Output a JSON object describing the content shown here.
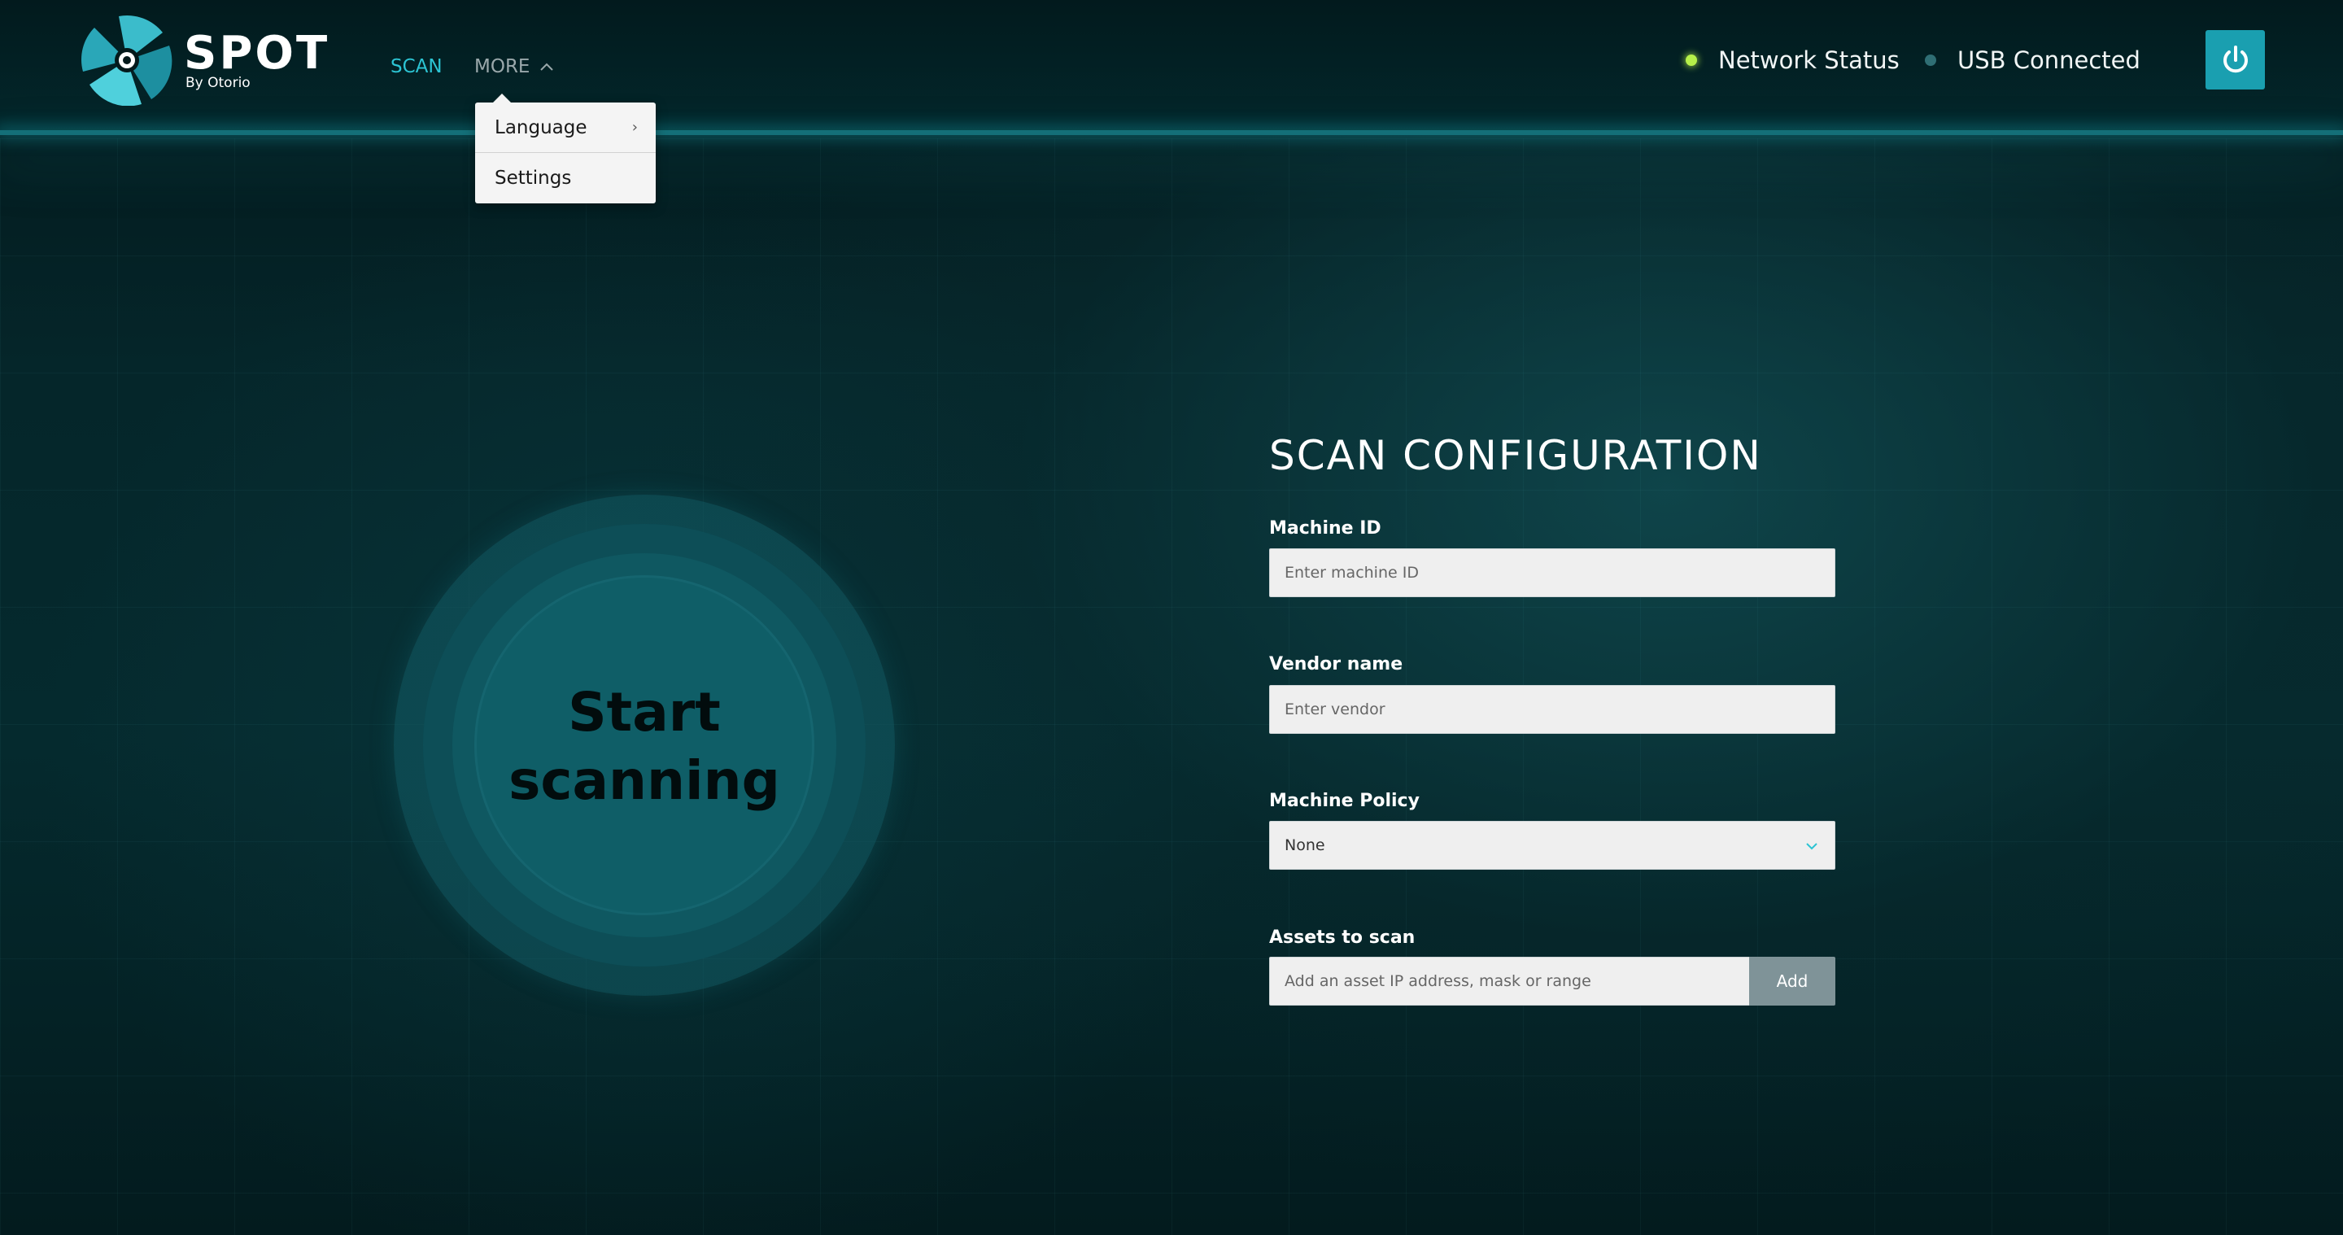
{
  "brand": {
    "title": "SPOT",
    "subtitle": "By Otorio",
    "logo_icon": "fan-logo-icon"
  },
  "nav": {
    "scan": "SCAN",
    "more": "MORE",
    "more_icon": "chevron-up-icon",
    "more_menu": {
      "open": true,
      "items": [
        {
          "label": "Language",
          "icon": "chevron-right-icon"
        },
        {
          "label": "Settings"
        }
      ]
    }
  },
  "status": {
    "network": {
      "label": "Network Status",
      "color": "#b6f04a"
    },
    "usb": {
      "label": "USB Connected",
      "color": "#2f6e74"
    }
  },
  "power_icon": "power-icon",
  "scan_button": {
    "label": "Start\nscanning"
  },
  "config": {
    "title": "SCAN CONFIGURATION",
    "machine_id": {
      "label": "Machine ID",
      "placeholder": "Enter machine ID",
      "value": ""
    },
    "vendor": {
      "label": "Vendor name",
      "placeholder": "Enter vendor",
      "value": ""
    },
    "policy": {
      "label": "Machine Policy",
      "value": "None",
      "icon": "chevron-down-icon"
    },
    "assets": {
      "label": "Assets to scan",
      "placeholder": "Add an asset IP address, mask or range",
      "add_label": "Add"
    }
  },
  "colors": {
    "accent": "#2cc4d3",
    "power_button": "#1a9fb0",
    "add_button": "#7f9398",
    "background": "#04191b"
  }
}
